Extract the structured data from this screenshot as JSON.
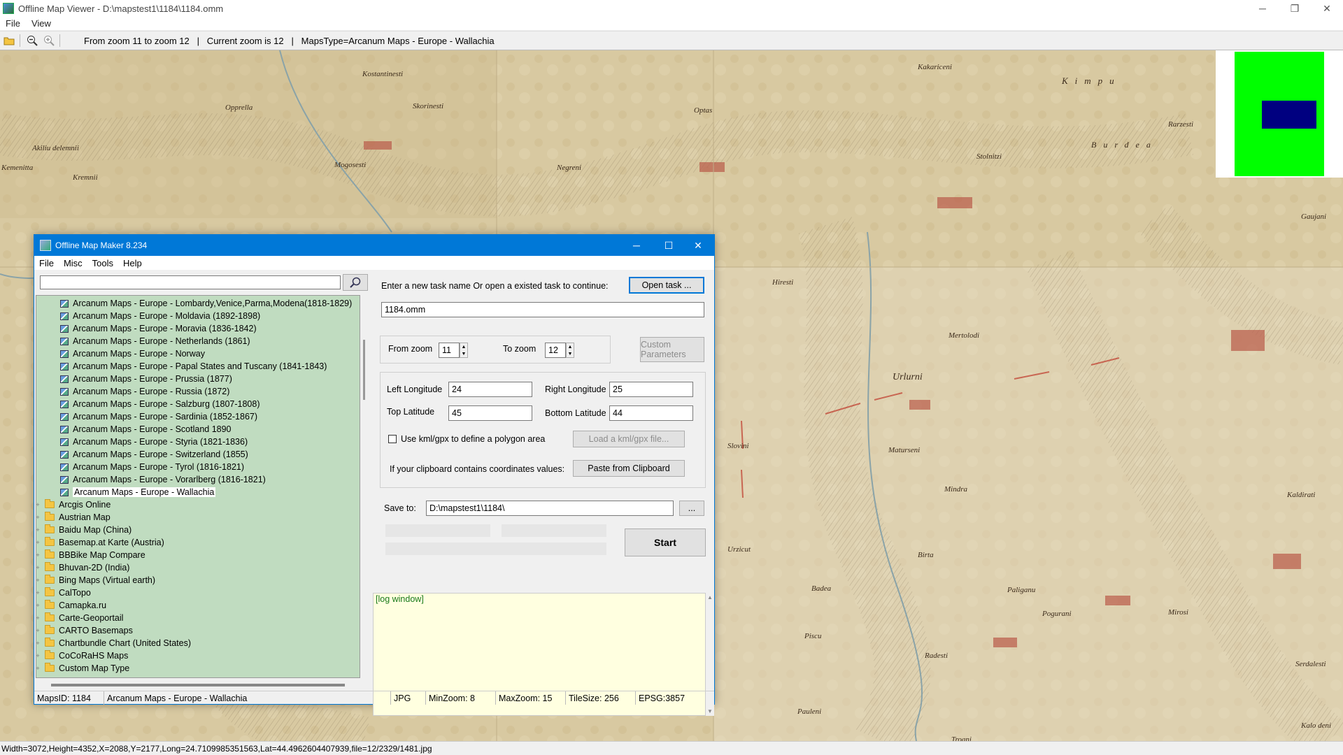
{
  "window": {
    "title": "Offline Map Viewer - D:\\mapstest1\\1184\\1184.omm",
    "controls": {
      "minimize": "─",
      "restore": "❐",
      "close": "✕"
    }
  },
  "menu": {
    "file": "File",
    "view": "View"
  },
  "toolbar": {
    "status": "From zoom 11 to zoom 12   |   Current zoom is 12   |   MapsType=Arcanum Maps - Europe - Wallachia"
  },
  "map_labels": [
    "Kostantinesti",
    "Opprella",
    "Akiliu delemnii",
    "Kemenitta",
    "Kremnii",
    "Mogosesti",
    "Skorinesti",
    "Optas",
    "Negreni",
    "Kakariceni",
    "Stolnitzi",
    "Kimpu",
    "Burdea",
    "Rarzesti",
    "Hiresti",
    "Mertolodi",
    "Urlurni",
    "Maturseni",
    "Mindra",
    "Birta",
    "Paliganu",
    "Pogurani",
    "Mirosi",
    "Radesti",
    "Pauleni",
    "Troani",
    "Kaldirati",
    "Gaujani",
    "Serdalesti",
    "Kalo deni",
    "Urzicut",
    "Slovini",
    "Badea",
    "Piscu"
  ],
  "statusbar": {
    "text": "Width=3072,Height=4352,X=2088,Y=2177,Long=24.7109985351563,Lat=44.4962604407939,file=12/2329/1481.jpg"
  },
  "dialog": {
    "title": "Offline Map Maker 8.234",
    "menu": {
      "file": "File",
      "misc": "Misc",
      "tools": "Tools",
      "help": "Help"
    },
    "search": {
      "value": ""
    },
    "tree": {
      "children": [
        "Arcanum Maps - Europe - Lombardy,Venice,Parma,Modena(1818-1829)",
        "Arcanum Maps - Europe - Moldavia (1892-1898)",
        "Arcanum Maps - Europe - Moravia (1836-1842)",
        "Arcanum Maps - Europe - Netherlands (1861)",
        "Arcanum Maps - Europe - Norway",
        "Arcanum Maps - Europe - Papal States and Tuscany (1841-1843)",
        "Arcanum Maps - Europe - Prussia (1877)",
        "Arcanum Maps - Europe - Russia (1872)",
        "Arcanum Maps - Europe - Salzburg (1807-1808)",
        "Arcanum Maps - Europe - Sardinia (1852-1867)",
        "Arcanum Maps - Europe - Scotland 1890",
        "Arcanum Maps - Europe - Styria (1821-1836)",
        "Arcanum Maps - Europe - Switzerland (1855)",
        "Arcanum Maps - Europe - Tyrol (1816-1821)",
        "Arcanum Maps - Europe - Vorarlberg (1816-1821)",
        "Arcanum Maps - Europe - Wallachia"
      ],
      "folders": [
        "Arcgis Online",
        "Austrian Map",
        "Baidu Map (China)",
        "Basemap.at Karte (Austria)",
        "BBBike Map Compare",
        "Bhuvan-2D (India)",
        "Bing Maps (Virtual earth)",
        "CalTopo",
        "Camapka.ru",
        "Carte-Geoportail",
        "CARTO Basemaps",
        "Chartbundle Chart (United States)",
        "CoCoRaHS Maps",
        "Custom Map Type"
      ]
    },
    "task": {
      "prompt": "Enter a new task name Or open a existed task to continue:",
      "open_button": "Open task ...",
      "name_value": "1184.omm"
    },
    "zoom": {
      "from_label": "From zoom",
      "from_value": "11",
      "to_label": "To zoom",
      "to_value": "12",
      "custom_button": "Custom Parameters"
    },
    "coords": {
      "left_label": "Left Longitude",
      "left_value": "24",
      "right_label": "Right Longitude",
      "right_value": "25",
      "top_label": "Top Latitude",
      "top_value": "45",
      "bottom_label": "Bottom Latitude",
      "bottom_value": "44",
      "kml_label": "Use kml/gpx to define a polygon area",
      "kml_button": "Load a kml/gpx file...",
      "clipboard_label": "If your clipboard contains coordinates values:",
      "clipboard_button": "Paste from Clipboard"
    },
    "save": {
      "label": "Save to:",
      "value": "D:\\mapstest1\\1184\\",
      "browse": "..."
    },
    "start_button": "Start",
    "log_text": "[log window]",
    "status": {
      "maps_id": "MapsID: 1184",
      "map_name": "Arcanum Maps - Europe - Wallachia",
      "format": "JPG",
      "min_zoom": "MinZoom: 8",
      "max_zoom": "MaxZoom: 15",
      "tile_size": "TileSize: 256",
      "epsg": "EPSG:3857"
    }
  }
}
